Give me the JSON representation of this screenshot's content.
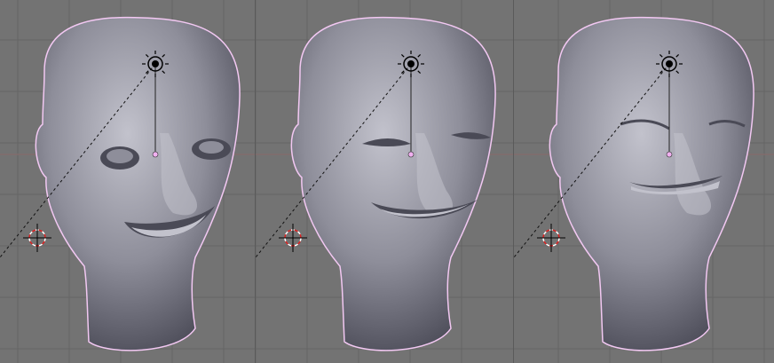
{
  "colors": {
    "background": "#737373",
    "grid": "#656565",
    "grid_axis_red": "#8a6a6a",
    "grid_axis_blue": "#6a6a8a",
    "mesh_light": "#c2c2cc",
    "mesh_mid": "#8e8e9a",
    "mesh_dark": "#4a4a56",
    "selection_outline": "#f2c8f2",
    "panel_border": "#5a5a5a"
  },
  "viewports": [
    {
      "name": "viewport-left",
      "expression": "wide-eyes-smile"
    },
    {
      "name": "viewport-middle",
      "expression": "squint-smile"
    },
    {
      "name": "viewport-right",
      "expression": "closed-eyes-grin"
    }
  ]
}
